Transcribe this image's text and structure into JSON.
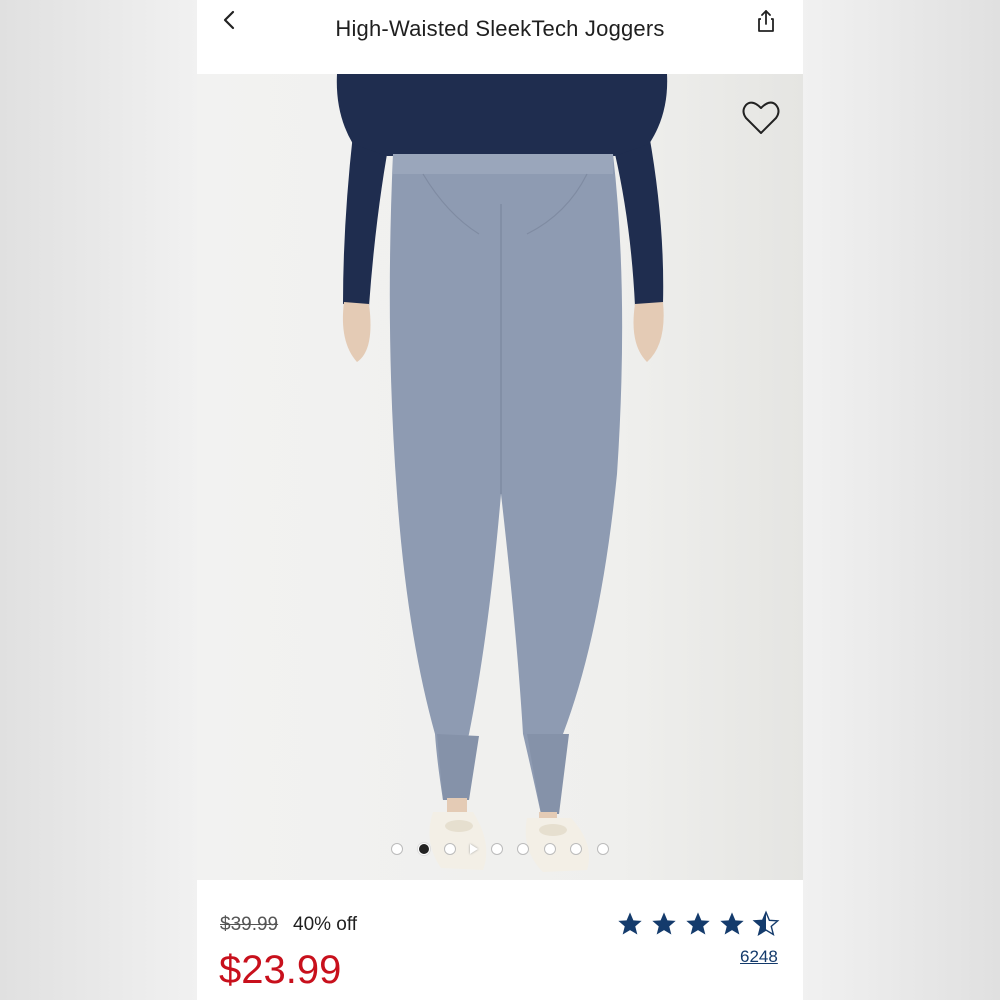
{
  "header": {
    "title": "High-Waisted SleekTech Joggers",
    "back_icon": "chevron-left-icon",
    "share_icon": "share-icon"
  },
  "gallery": {
    "favorite_icon": "heart-icon",
    "image_count": 9,
    "active_index": 1,
    "has_video": true,
    "pant_color": "#8e9bb2",
    "sweater_color": "#1f2d4f"
  },
  "pricing": {
    "original_price": "$39.99",
    "discount": "40% off",
    "sale_price": "$23.99",
    "sale_color": "#c8101c"
  },
  "rating": {
    "value": 4.5,
    "max": 5,
    "review_count": "6248",
    "star_color": "#143b6c"
  }
}
